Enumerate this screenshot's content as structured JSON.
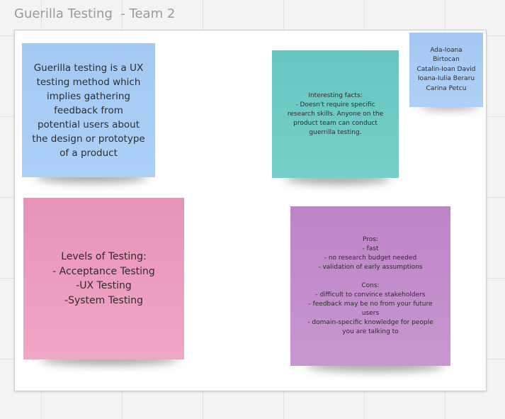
{
  "board": {
    "title": "Guerilla Testing  - Team 2"
  },
  "notes": {
    "definition": {
      "text": "Guerilla testing is a UX\ntesting method which\nimplies gathering\nfeedback from\npotential users about\nthe design or prototype\nof a product",
      "color": "#a8ccf5"
    },
    "facts": {
      "text": "Interesting facts:\n- Doesn't require specific\nresearch skills. Anyone on the\nproduct team can conduct\nguerrilla testing.",
      "color": "#6ccac3"
    },
    "team": {
      "text": "Ada-Ioana\nBirtocan\nCatalin-Ioan David\nIoana-Iulia Beraru\nCarina Petcu",
      "color": "#a9cbf4"
    },
    "levels": {
      "text": "Levels of Testing:\n- Acceptance Testing\n-UX Testing\n-System Testing",
      "color": "#ec9cbf"
    },
    "proscons": {
      "text": "Pros:\n- fast\n- no research budget needed\n- validation of early assumptions\n\nCons:\n- difficult to convince stakeholders\n- feedback may be no from your future\nusers\n- domain-specific knowledge for people\nyou are talking to",
      "color": "#c38ccc"
    }
  }
}
